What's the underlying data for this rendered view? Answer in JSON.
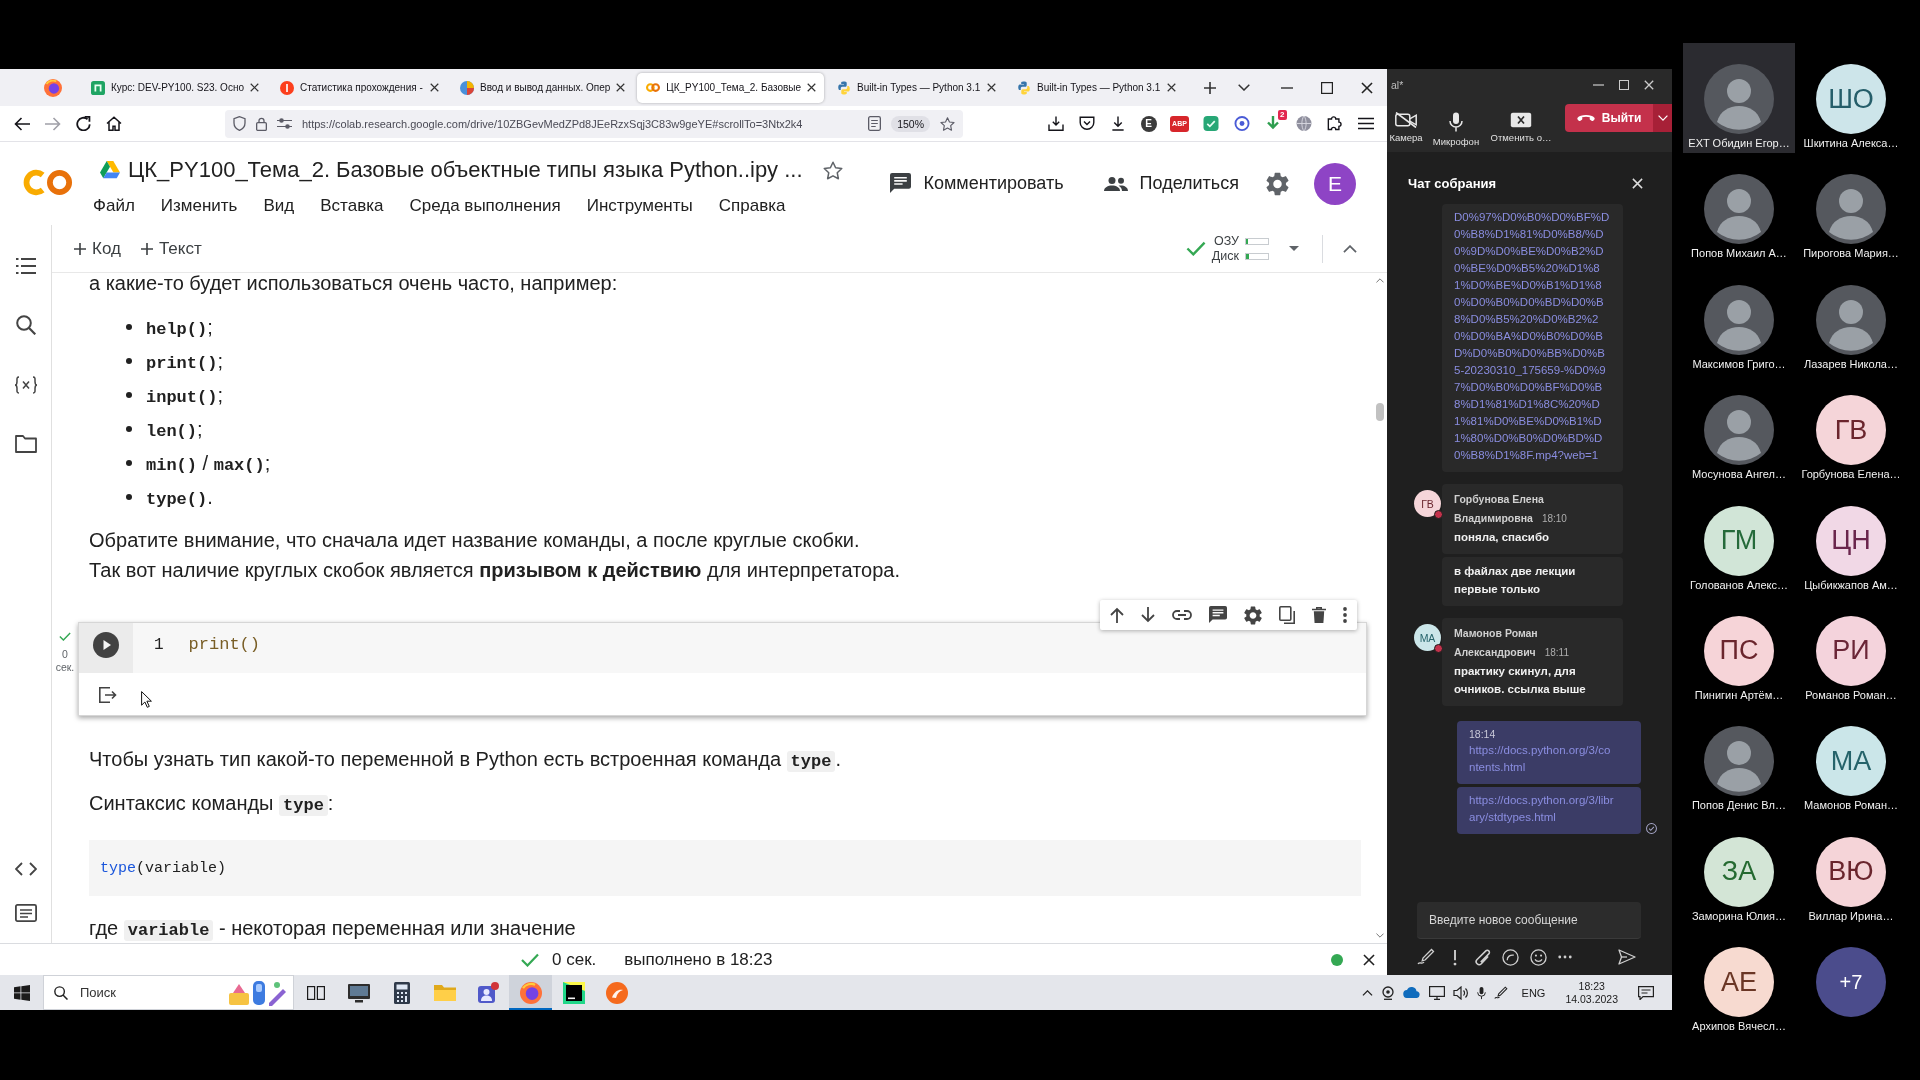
{
  "browser": {
    "tabs": [
      {
        "kind": "course",
        "title": "Курс: DEV-PY100. S23. Осно",
        "selected": false
      },
      {
        "kind": "stats",
        "title": "Статистика прохождения -",
        "selected": false
      },
      {
        "kind": "article",
        "title": "Ввод и вывод данных. Опер",
        "selected": false
      },
      {
        "kind": "notebook",
        "title": "ЦК_PY100_Тема_2. Базовые",
        "selected": true
      },
      {
        "kind": "docs",
        "title": "Built-in Types — Python 3.1",
        "selected": false
      },
      {
        "kind": "docs",
        "title": "Built-in Types — Python 3.1",
        "selected": false
      }
    ],
    "url": "https://colab.research.google.com/drive/10ZBGevMedZPd8JEeRzxSqj3C83w9geYE#scrollTo=3Ntx2k4",
    "zoom": "150%",
    "extensions": [
      {
        "kind": "save"
      },
      {
        "kind": "pocket"
      },
      {
        "kind": "download"
      },
      {
        "kind": "letter",
        "label": "E"
      },
      {
        "kind": "adblock",
        "label": "ABP"
      },
      {
        "kind": "square"
      },
      {
        "kind": "ring"
      },
      {
        "kind": "badged",
        "label": "2"
      },
      {
        "kind": "globe"
      },
      {
        "kind": "puzzle"
      },
      {
        "kind": "menu"
      }
    ]
  },
  "notebook": {
    "title": "ЦК_PY100_Тема_2. Базовые объектные типы языка Python..ipy ...",
    "starred": false,
    "menu": [
      "Файл",
      "Изменить",
      "Вид",
      "Вставка",
      "Среда выполнения",
      "Инструменты",
      "Справка"
    ],
    "actions": [
      {
        "kind": "comment",
        "label": "Комментировать"
      },
      {
        "kind": "share",
        "label": "Поделиться"
      }
    ],
    "account_initial": "E",
    "add_buttons": [
      "Код",
      "Текст"
    ],
    "resources": [
      {
        "label": "ОЗУ",
        "level": 0.1
      },
      {
        "label": "Диск",
        "level": 0.15
      }
    ],
    "connected": true,
    "blocks": [
      {
        "kind": "paragraph",
        "lines": [
          {
            "segments": [
              {
                "kind": "text",
                "text": "а какие-то будет использоваться очень часто, например:"
              }
            ]
          }
        ]
      },
      {
        "kind": "bullets",
        "items": [
          {
            "segments": [
              {
                "kind": "code",
                "text": "help()"
              },
              {
                "kind": "text",
                "text": ";"
              }
            ]
          },
          {
            "segments": [
              {
                "kind": "code",
                "text": "print()"
              },
              {
                "kind": "text",
                "text": ";"
              }
            ]
          },
          {
            "segments": [
              {
                "kind": "code",
                "text": "input()"
              },
              {
                "kind": "text",
                "text": ";"
              }
            ]
          },
          {
            "segments": [
              {
                "kind": "code",
                "text": "len()"
              },
              {
                "kind": "text",
                "text": ";"
              }
            ]
          },
          {
            "segments": [
              {
                "kind": "code",
                "text": "min()"
              },
              {
                "kind": "text",
                "text": " / "
              },
              {
                "kind": "code",
                "text": "max()"
              },
              {
                "kind": "text",
                "text": ";"
              }
            ]
          },
          {
            "segments": [
              {
                "kind": "code",
                "text": "type()"
              },
              {
                "kind": "text",
                "text": "."
              }
            ]
          }
        ]
      },
      {
        "kind": "paragraph",
        "lines": [
          {
            "segments": [
              {
                "kind": "text",
                "text": "Обратите внимание, что сначала идет название команды, а после круглые скобки."
              }
            ]
          },
          {
            "segments": [
              {
                "kind": "text",
                "text": "Так вот наличие круглых скобок является **призывом к действию** для интерпретатора."
              }
            ]
          }
        ]
      },
      {
        "kind": "code_cell",
        "selected": true,
        "executed": true,
        "exec_time": "0",
        "exec_unit": "сек.",
        "line": "1",
        "tokens": [
          {
            "kind": "function",
            "text": "print()"
          }
        ]
      },
      {
        "kind": "paragraph",
        "lines": [
          {
            "segments": [
              {
                "kind": "text",
                "text": "Чтобы узнать тип какой-то переменной в Python есть встроенная команда "
              },
              {
                "kind": "code",
                "text": "type"
              },
              {
                "kind": "text",
                "text": "."
              }
            ]
          }
        ]
      },
      {
        "kind": "paragraph",
        "lines": [
          {
            "segments": [
              {
                "kind": "text",
                "text": "Синтаксис команды "
              },
              {
                "kind": "code",
                "text": "type"
              },
              {
                "kind": "text",
                "text": ":"
              }
            ]
          }
        ]
      },
      {
        "kind": "code_block",
        "tokens": [
          {
            "kind": "builtin",
            "text": "type"
          },
          {
            "kind": "plain",
            "text": "(variable)"
          }
        ]
      },
      {
        "kind": "paragraph",
        "lines": [
          {
            "segments": [
              {
                "kind": "text",
                "text": "где "
              },
              {
                "kind": "code",
                "text": "variable"
              },
              {
                "kind": "text",
                "text": " - некоторая переменная или значение"
              }
            ]
          }
        ]
      }
    ],
    "status": {
      "done": true,
      "duration": "0 сек.",
      "message": "выполнено в 18:23"
    }
  },
  "meeting": {
    "title": "al*",
    "controls": [
      {
        "kind": "camera",
        "label": "Камера",
        "on": false
      },
      {
        "kind": "mic",
        "label": "Микрофон",
        "on": true
      },
      {
        "kind": "share",
        "label": "Отменить о…",
        "on": true
      }
    ],
    "leave": "Выйти",
    "chat": {
      "title": "Чат собрания",
      "messages": [
        {
          "kind": "incoming",
          "bubbles": [
            {
              "kind": "link",
              "text": "D0%97%D0%B0%D0%BF%D0%B8%D1%81%D0%B8/%D0%9D%D0%BE%D0%B2%D0%BE%D0%B5%20%D1%81%D0%BE%D0%B1%D1%80%D0%B0%D0%BD%D0%B8%D0%B5%20%D0%B2%20%D0%BA%D0%B0%D0%BD%D0%B0%D0%BB%D0%B5-20230310_175659-%D0%97%D0%B0%D0%BF%D0%B8%D1%81%D1%8C%20%D1%81%D0%BE%D0%B1%D1%80%D0%B0%D0%BD%D0%B8%D1%8F.mp4?web=1"
            }
          ]
        },
        {
          "kind": "incoming",
          "author": "Горбунова Елена Владимировна",
          "initials": "ГВ",
          "color": "#f5d5d9",
          "busy": true,
          "time": "18:10",
          "bubbles": [
            {
              "kind": "text",
              "text": "поняла, спасибо"
            },
            {
              "kind": "text",
              "text": "в файлах две лекции первые только"
            }
          ]
        },
        {
          "kind": "incoming",
          "author": "Мамонов Роман Александрович",
          "initials": "МА",
          "color": "#cbe6e9",
          "busy": true,
          "time": "18:11",
          "bubbles": [
            {
              "kind": "text",
              "text": "практику скинул, для очников. ссылка выше"
            }
          ]
        },
        {
          "kind": "outgoing",
          "time": "18:14",
          "bubbles": [
            {
              "kind": "link",
              "text": "https://docs.python.org/3/contents.html"
            },
            {
              "kind": "link",
              "text": "https://docs.python.org/3/library/stdtypes.html"
            }
          ]
        }
      ],
      "placeholder": "Введите новое сообщение"
    },
    "participants": [
      {
        "kind": "photo",
        "name": "EXT Обидин Егор…",
        "highlighted": true
      },
      {
        "kind": "photo",
        "name": "Попов Михаил А…",
        "highlighted": false
      },
      {
        "kind": "photo",
        "name": "Максимов Григо…",
        "highlighted": false
      },
      {
        "kind": "photo",
        "name": "Мосунова Ангел…",
        "highlighted": false
      },
      {
        "kind": "initials",
        "initials": "ГМ",
        "name": "Голованов Алекс…",
        "color": "#d1e5d7",
        "highlighted": false
      },
      {
        "kind": "initials",
        "initials": "ПС",
        "name": "Пинигин Артём…",
        "color": "#f6d4d8",
        "highlighted": false
      },
      {
        "kind": "photo",
        "name": "Попов Денис Вл…",
        "highlighted": false
      },
      {
        "kind": "initials",
        "initials": "ЗА",
        "name": "Заморина Юлия…",
        "color": "#d3e5d6",
        "highlighted": false
      },
      {
        "kind": "initials",
        "initials": "АЕ",
        "name": "Архипов Вячесл…",
        "color": "#f7dad0",
        "highlighted": false
      },
      {
        "kind": "initials",
        "initials": "ШО",
        "name": "Шкитина Алекса…",
        "color": "#cde5ea",
        "highlighted": false
      },
      {
        "kind": "photo",
        "name": "Пирогова Мария…",
        "highlighted": false
      },
      {
        "kind": "photo",
        "name": "Лазарев Никола…",
        "highlighted": false
      },
      {
        "kind": "initials",
        "initials": "ГВ",
        "name": "Горбунова Елена…",
        "color": "#f5d5d9",
        "highlighted": false
      },
      {
        "kind": "initials",
        "initials": "ЦН",
        "name": "Цыбикжапов Ам…",
        "color": "#f1d8e6",
        "highlighted": false
      },
      {
        "kind": "initials",
        "initials": "РИ",
        "name": "Романов Роман…",
        "color": "#f4d3dc",
        "highlighted": false
      },
      {
        "kind": "initials",
        "initials": "МА",
        "name": "Мамонов Роман…",
        "color": "#cbe6e9",
        "highlighted": false
      },
      {
        "kind": "initials",
        "initials": "ВЮ",
        "name": "Виллар Ирина…",
        "color": "#f5d4d8",
        "highlighted": false
      },
      {
        "kind": "more",
        "label": "+7",
        "color": "#4b4c8c",
        "highlighted": false
      }
    ]
  },
  "taskbar": {
    "search_placeholder": "Поиск",
    "apps": [
      {
        "kind": "taskview",
        "selected": false
      },
      {
        "kind": "monitor",
        "selected": false
      },
      {
        "kind": "calculator",
        "selected": false
      },
      {
        "kind": "folder",
        "selected": false
      },
      {
        "kind": "chat",
        "selected": false
      },
      {
        "kind": "browser",
        "selected": true
      },
      {
        "kind": "editor",
        "selected": false
      },
      {
        "kind": "circle",
        "selected": false
      }
    ],
    "language": "ENG",
    "time": "18:23",
    "date": "14.03.2023"
  }
}
